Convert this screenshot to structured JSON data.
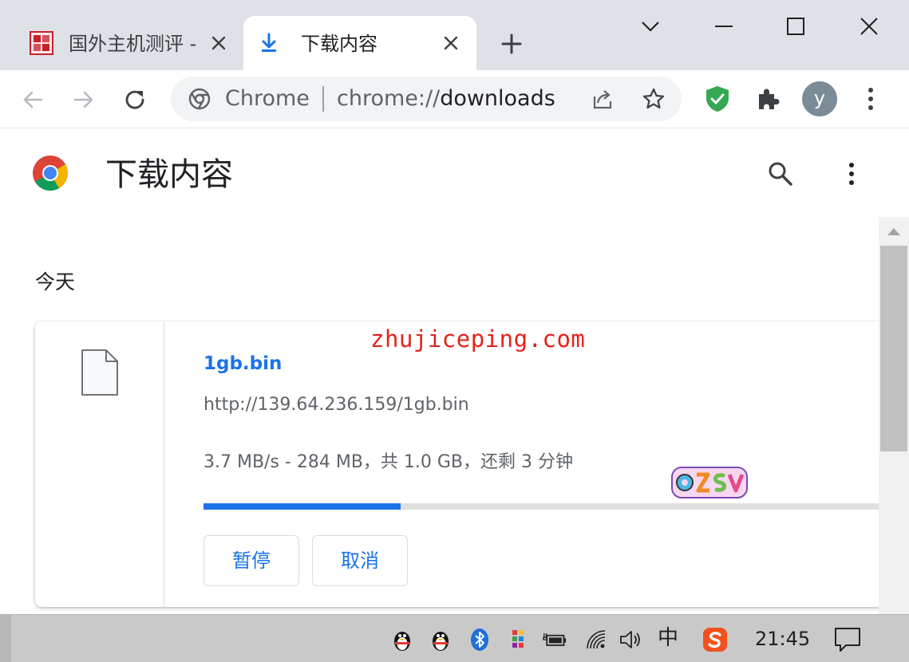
{
  "browser": {
    "tabs": [
      {
        "title": "国外主机测评 -",
        "favicon": "seal-icon",
        "active": false
      },
      {
        "title": "下载内容",
        "favicon": "download-icon",
        "active": true
      }
    ],
    "omnibox": {
      "chip": "Chrome",
      "url_scheme": "chrome://",
      "url_path": "downloads"
    },
    "profile_initial": "y"
  },
  "page": {
    "title": "下载内容",
    "date_heading": "今天",
    "watermark": "zhujiceping.com"
  },
  "downloads": [
    {
      "file_name": "1gb.bin",
      "url": "http://139.64.236.159/1gb.bin",
      "status": "3.7 MB/s - 284 MB，共 1.0 GB，还剩 3 分钟",
      "progress_fraction": 0.284,
      "pause_label": "暂停",
      "cancel_label": "取消"
    }
  ],
  "taskbar": {
    "ime": "中",
    "clock": "21:45"
  },
  "colors": {
    "accent": "#1a73e8",
    "tabstrip": "#dee1e6",
    "watermark": "#e2231a",
    "shield": "#34a853"
  }
}
